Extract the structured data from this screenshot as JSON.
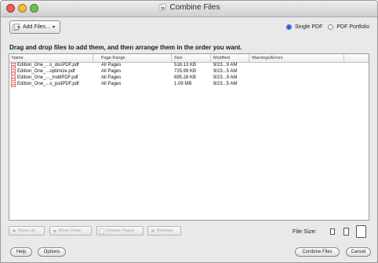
{
  "window": {
    "title": "Combine Files"
  },
  "toolbar": {
    "add_files_label": "Add Files...",
    "add_files_arrow": "▾",
    "single_pdf_label": "Single PDF",
    "pdf_portfolio_label": "PDF Portfolio",
    "selected_mode": "Single PDF"
  },
  "instructions": "Drag and drop files to add them, and then arrange them in the order you want.",
  "table": {
    "columns": [
      "Name",
      "Page Range",
      "Size",
      "Modified",
      "Warnings/Errors"
    ],
    "rows": [
      {
        "name": "Edition_One_...s_docPDF.pdf",
        "range": "All Pages",
        "size": "518.13 KB",
        "modified": "9/23...9 AM",
        "warnings": ""
      },
      {
        "name": "Edition_One_...optimize.pdf",
        "range": "All Pages",
        "size": "725.99 KB",
        "modified": "9/23...5 AM",
        "warnings": ""
      },
      {
        "name": "Edition_One_..._InddPDF.pdf",
        "range": "All Pages",
        "size": "695.28 KB",
        "modified": "9/23...9 AM",
        "warnings": ""
      },
      {
        "name": "Edition_One_...s_psdPDF.pdf",
        "range": "All Pages",
        "size": "1.09 MB",
        "modified": "9/23...5 AM",
        "warnings": ""
      }
    ]
  },
  "bottom": {
    "move_up_label": "Move Up",
    "move_down_label": "Move Down",
    "choose_pages_label": "Choose Pages",
    "remove_label": "Remove",
    "file_size_label": "File Size:"
  },
  "footer": {
    "help_label": "Help",
    "options_label": "Options",
    "combine_label": "Combine Files",
    "cancel_label": "Cancel"
  },
  "colors": {
    "close": "#ee5a52",
    "minimize": "#f4bd35",
    "zoom": "#6cc24a",
    "pdf_icon": "#cc2a2a",
    "radio_selected": "#1d5cd6"
  },
  "icons": [
    "combine-files-icon",
    "add-files-icon",
    "pdf-file-icon",
    "move-up-icon",
    "move-down-icon",
    "choose-pages-icon",
    "remove-icon",
    "file-size-small-icon",
    "file-size-medium-icon",
    "file-size-large-icon"
  ]
}
